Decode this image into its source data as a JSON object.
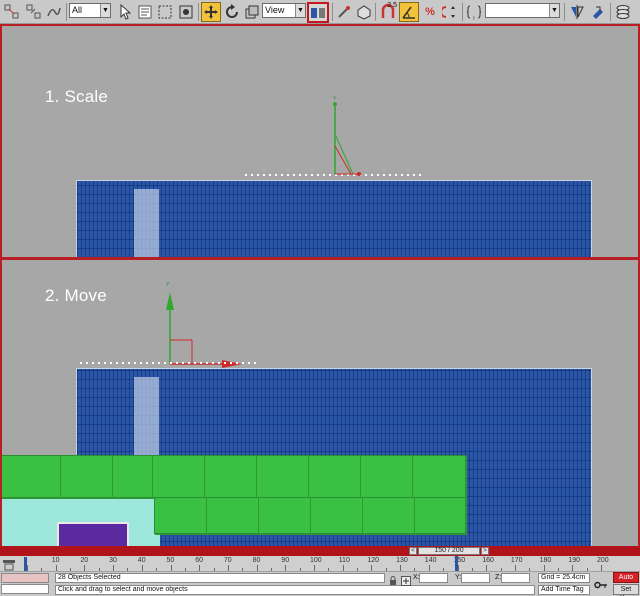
{
  "toolbar": {
    "selection_filter": "All",
    "coordinate_system": "View",
    "named_selection_placeholder": "",
    "angle_snap_label": "2.5",
    "percent_snap_label": "%",
    "cursor_label": "I"
  },
  "viewports": {
    "top": {
      "label": "1. Scale"
    },
    "bottom": {
      "label": "2. Move"
    }
  },
  "time_slider": {
    "position": "150 / 200",
    "prev_arrow": "<",
    "next_arrow": ">"
  },
  "track_ticks": [
    "10",
    "20",
    "30",
    "40",
    "50",
    "60",
    "70",
    "80",
    "90",
    "100",
    "110",
    "120",
    "130",
    "140",
    "150",
    "160",
    "170",
    "180",
    "190",
    "200"
  ],
  "status_bar": {
    "selection_count": "28 Objects Selected",
    "prompt": "Click and drag to select and move objects",
    "x_label": "X:",
    "y_label": "Y:",
    "z_label": "Z:",
    "x_value": "",
    "y_value": "",
    "z_value": "",
    "grid": "Grid = 25.4cm",
    "add_time_tag": "Add Time Tag",
    "auto_key": "Auto Key",
    "set_key": "Set Key"
  },
  "colors": {
    "active_border": "#b81f24",
    "blue_panel": "#2a56a7",
    "green_objects": "#3ac043",
    "purple_object": "#5c2aa0",
    "teal_object": "#9de6dc",
    "viewport_bg": "#a7a7a7",
    "highlight_button": "#f2c33a"
  },
  "icons": [
    "select-region-icon",
    "select-by-name-icon",
    "rectangular-selection-icon",
    "window-crossing-icon",
    "move-icon",
    "rotate-icon",
    "scale-icon",
    "use-pivot-center-icon",
    "selection-lock-icon",
    "snap-toggle-icon",
    "angle-snap-icon",
    "percent-snap-icon",
    "spinner-snap-icon",
    "edit-named-selection-icon",
    "mirror-icon",
    "align-icon",
    "layer-manager-icon",
    "key-icon",
    "lock-icon",
    "absolute-mode-icon",
    "time-config-icon"
  ]
}
